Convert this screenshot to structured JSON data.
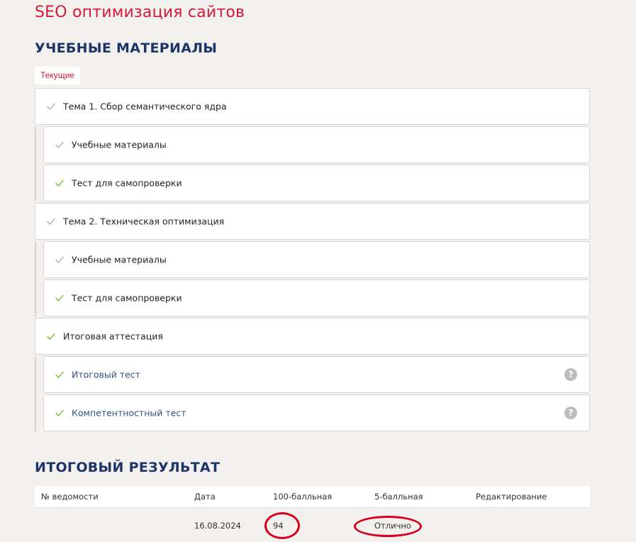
{
  "course": {
    "title": "SEO оптимизация сайтов"
  },
  "materials": {
    "heading": "УЧЕБНЫЕ МАТЕРИАЛЫ",
    "tab_current": "Текущие",
    "topics": [
      {
        "label": "Тема 1. Сбор семантического ядра",
        "done": false,
        "items": [
          {
            "label": "Учебные материалы",
            "done": false,
            "link": false,
            "help": false
          },
          {
            "label": "Тест для самопроверки",
            "done": true,
            "link": false,
            "help": false
          }
        ]
      },
      {
        "label": "Тема 2. Техническая оптимизация",
        "done": false,
        "items": [
          {
            "label": "Учебные материалы",
            "done": false,
            "link": false,
            "help": false
          },
          {
            "label": "Тест для самопроверки",
            "done": true,
            "link": false,
            "help": false
          }
        ]
      },
      {
        "label": "Итоговая аттестация",
        "done": true,
        "items": [
          {
            "label": "Итоговый тест",
            "done": true,
            "link": true,
            "help": true
          },
          {
            "label": "Компетентностный тест",
            "done": true,
            "link": true,
            "help": true
          }
        ]
      }
    ],
    "help_glyph": "?"
  },
  "results": {
    "heading": "ИТОГОВЫЙ РЕЗУЛЬТАТ",
    "columns": [
      "№ ведомости",
      "Дата",
      "100-балльная",
      "5-балльная",
      "Редактирование"
    ],
    "rows": [
      [
        "",
        "16.08.2024",
        "94",
        "Отлично",
        ""
      ]
    ]
  },
  "colors": {
    "accent": "#d7193a",
    "heading": "#1f3468",
    "check_done": "#8cc63f",
    "check_pending": "#b8b8b8",
    "annotation": "#d8001f"
  },
  "icons": {
    "check": "check-icon",
    "help": "help-icon"
  }
}
